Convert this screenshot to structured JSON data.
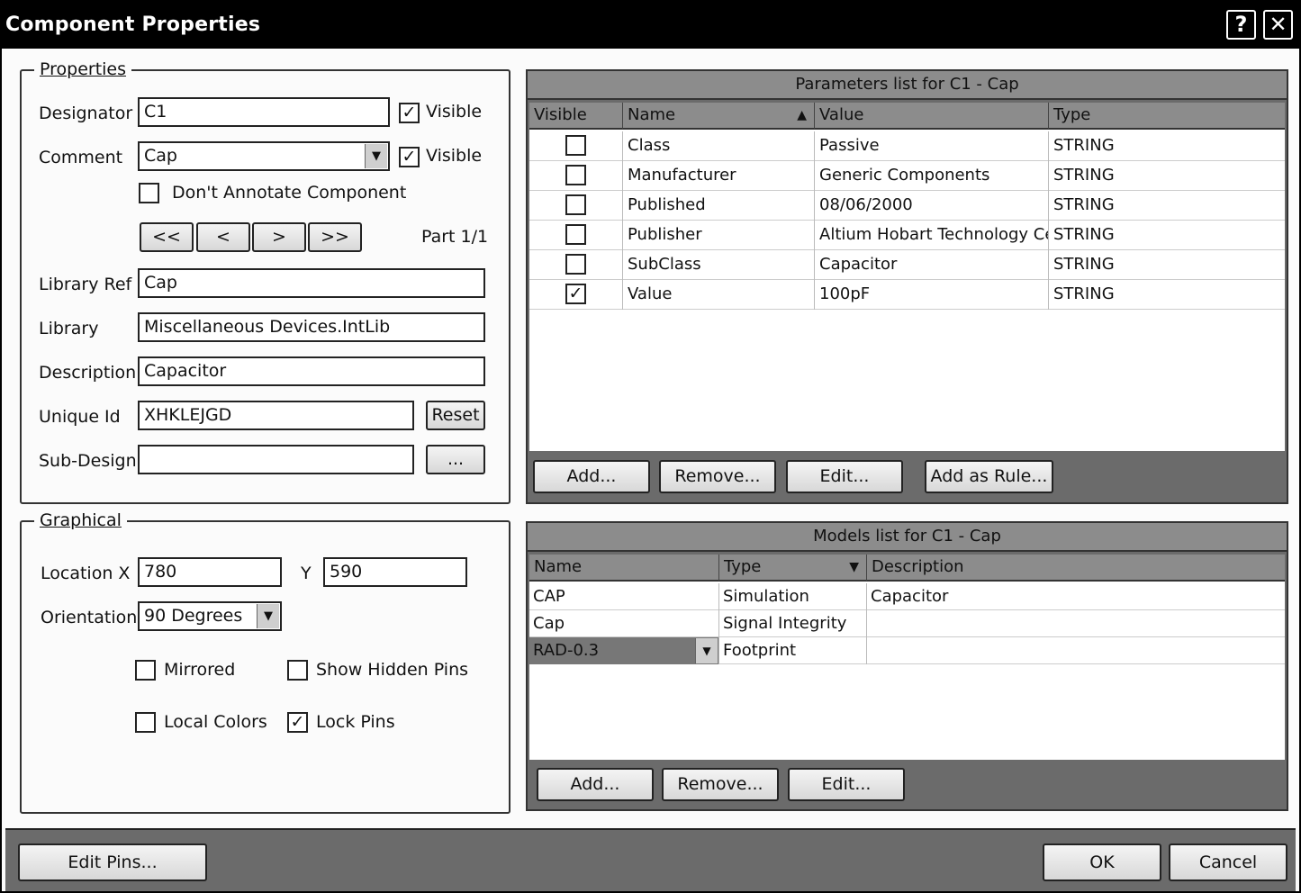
{
  "window": {
    "title": "Component Properties",
    "help_label": "?",
    "close_label": "✕"
  },
  "properties": {
    "legend": "Properties",
    "designator_label": "Designator",
    "designator_value": "C1",
    "comment_label": "Comment",
    "comment_value": "Cap",
    "visible_label": "Visible",
    "designator_visible": true,
    "comment_visible": true,
    "dont_annotate_label": "Don't Annotate Component",
    "dont_annotate": false,
    "nav_first": "<<",
    "nav_prev": "<",
    "nav_next": ">",
    "nav_last": ">>",
    "part_label": "Part 1/1",
    "library_ref_label": "Library Ref",
    "library_ref_value": "Cap",
    "library_label": "Library",
    "library_value": "Miscellaneous Devices.IntLib",
    "description_label": "Description",
    "description_value": "Capacitor",
    "unique_id_label": "Unique Id",
    "unique_id_value": "XHKLEJGD",
    "reset_label": "Reset",
    "sub_design_label": "Sub-Design",
    "sub_design_value": "",
    "browse_label": "..."
  },
  "graphical": {
    "legend": "Graphical",
    "location_label": "Location X",
    "location_x": "780",
    "y_label": "Y",
    "location_y": "590",
    "orientation_label": "Orientation",
    "orientation_value": "90 Degrees",
    "mirrored_label": "Mirrored",
    "mirrored": false,
    "show_hidden_pins_label": "Show Hidden Pins",
    "show_hidden_pins": false,
    "local_colors_label": "Local Colors",
    "local_colors": false,
    "lock_pins_label": "Lock Pins",
    "lock_pins": true
  },
  "parameters": {
    "title": "Parameters list for C1 - Cap",
    "headers": {
      "visible": "Visible",
      "name": "Name",
      "sort_icon": "▲",
      "value": "Value",
      "type": "Type"
    },
    "rows": [
      {
        "visible": false,
        "name": "Class",
        "value": "Passive",
        "type": "STRING"
      },
      {
        "visible": false,
        "name": "Manufacturer",
        "value": "Generic Components",
        "type": "STRING"
      },
      {
        "visible": false,
        "name": "Published",
        "value": "08/06/2000",
        "type": "STRING"
      },
      {
        "visible": false,
        "name": "Publisher",
        "value": "Altium Hobart Technology Cen",
        "type": "STRING"
      },
      {
        "visible": false,
        "name": "SubClass",
        "value": "Capacitor",
        "type": "STRING"
      },
      {
        "visible": true,
        "name": "Value",
        "value": "100pF",
        "type": "STRING"
      }
    ],
    "buttons": {
      "add": "Add...",
      "remove": "Remove...",
      "edit": "Edit...",
      "add_as_rule": "Add as Rule..."
    }
  },
  "models": {
    "title": "Models list for C1 - Cap",
    "headers": {
      "name": "Name",
      "type": "Type",
      "sort_icon": "▼",
      "description": "Description"
    },
    "rows": [
      {
        "name": "CAP",
        "type": "Simulation",
        "description": "Capacitor"
      },
      {
        "name": "Cap",
        "type": "Signal Integrity",
        "description": ""
      },
      {
        "name": "RAD-0.3",
        "type": "Footprint",
        "description": ""
      }
    ],
    "buttons": {
      "add": "Add...",
      "remove": "Remove...",
      "edit": "Edit..."
    }
  },
  "footer": {
    "edit_pins": "Edit Pins...",
    "ok": "OK",
    "cancel": "Cancel"
  }
}
